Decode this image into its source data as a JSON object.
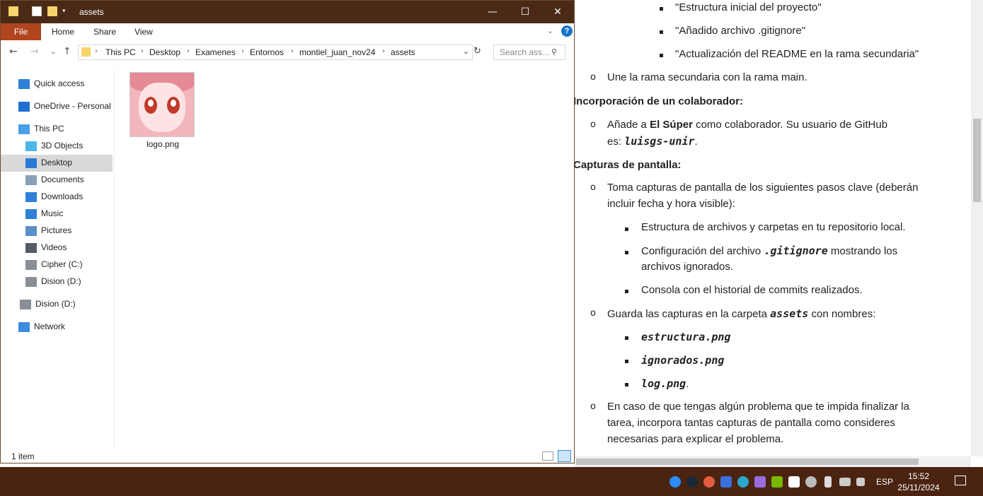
{
  "document": {
    "lines": [
      {
        "bullet": "square",
        "text": "\"Estructura inicial del proyecto\""
      },
      {
        "bullet": "square",
        "text": "\"Añadido archivo .gitignore\""
      },
      {
        "bullet": "square",
        "text": "\"Actualización del README en la rama secundaria\""
      },
      {
        "bullet": "circle",
        "text": "Une la rama secundaria con la rama main."
      }
    ],
    "heading_collab": "Incorporación de un colaborador:",
    "collab_prefix": "Añade a ",
    "collab_bold": "El Súper",
    "collab_suffix": " como colaborador. Su usuario de GitHub",
    "collab_line2_prefix": "es: ",
    "collab_user": "luisgs-unir",
    "collab_line2_suffix": ".",
    "heading_capt": "Capturas de pantalla:",
    "capt1_l1": "Toma capturas de pantalla de los siguientes pasos clave (deberán",
    "capt1_l2": "incluir fecha y hora visible):",
    "capt_sub1": "Estructura de archivos y carpetas en tu repositorio local.",
    "capt_sub2_prefix": "Configuración del archivo ",
    "capt_sub2_code": ".gitignore",
    "capt_sub2_suffix": " mostrando los",
    "capt_sub2_l2": "archivos ignorados.",
    "capt_sub3": "Consola con el historial de commits realizados.",
    "capt2_prefix": "Guarda las capturas en la carpeta ",
    "capt2_code": "assets",
    "capt2_suffix": " con nombres:",
    "files": [
      "estructura.png",
      "ignorados.png",
      "log.png"
    ],
    "log_suffix": ".",
    "capt3_l1": "En caso de que tengas algún problema que te impida finalizar la",
    "capt3_l2": "tarea, incorpora tantas capturas de pantalla como consideres",
    "capt3_l3": "necesarias para explicar el problema."
  },
  "explorer": {
    "title": "assets",
    "ribbon": {
      "file": "File",
      "home": "Home",
      "share": "Share",
      "view": "View"
    },
    "breadcrumb": [
      "This PC",
      "Desktop",
      "Examenes",
      "Entornos",
      "montiel_juan_nov24",
      "assets"
    ],
    "search_placeholder": "Search ass...",
    "nav": [
      {
        "label": "Quick access",
        "icon": "star-icon"
      },
      {
        "label": "OneDrive - Personal",
        "icon": "cloud-icon"
      },
      {
        "label": "This PC",
        "icon": "computer-icon"
      },
      {
        "label": "3D Objects",
        "icon": "cube-icon"
      },
      {
        "label": "Desktop",
        "icon": "desktop-icon"
      },
      {
        "label": "Documents",
        "icon": "document-icon"
      },
      {
        "label": "Downloads",
        "icon": "download-icon"
      },
      {
        "label": "Music",
        "icon": "music-icon"
      },
      {
        "label": "Pictures",
        "icon": "pictures-icon"
      },
      {
        "label": "Videos",
        "icon": "video-icon"
      },
      {
        "label": "Cipher (C:)",
        "icon": "drive-icon"
      },
      {
        "label": "Dision (D:)",
        "icon": "drive-icon"
      },
      {
        "label": "Dision (D:)",
        "icon": "drive-icon"
      },
      {
        "label": "Network",
        "icon": "network-icon"
      }
    ],
    "file_name": "logo.png",
    "status": "1 item"
  },
  "taskbar": {
    "lang": "ESP",
    "time": "15:52",
    "date": "25/11/2024"
  },
  "colors": {
    "title_bg": "#4a2a16",
    "file_tab": "#b0451f",
    "taskbar": "#4a2410"
  }
}
